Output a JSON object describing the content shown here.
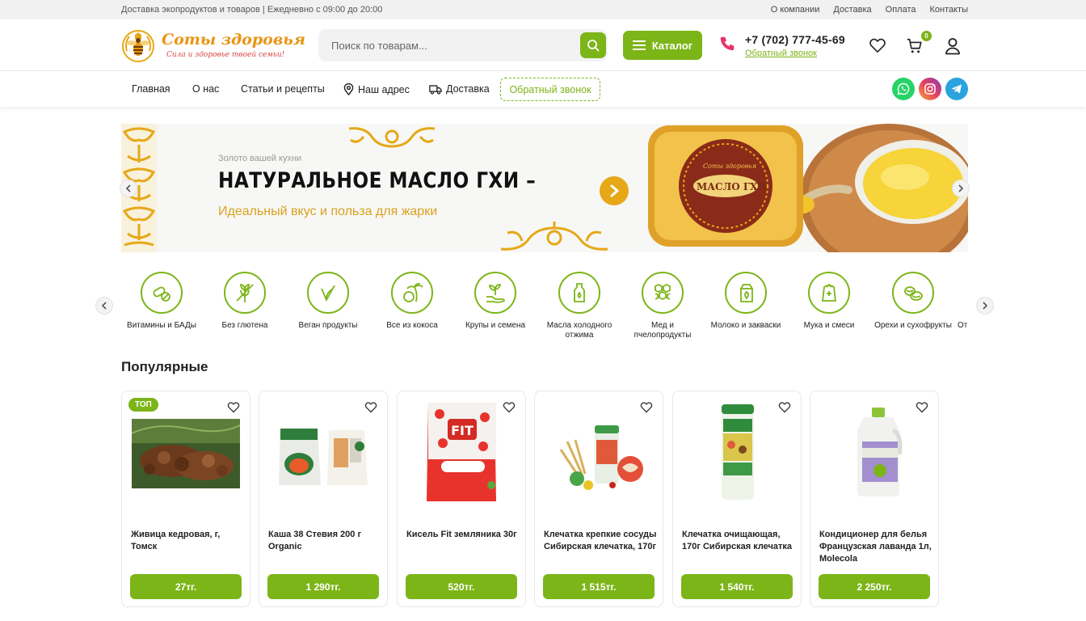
{
  "topbar": {
    "info": "Доставка экопродуктов и товаров | Ежедневно с 09:00 до 20:00",
    "links": [
      "О компании",
      "Доставка",
      "Оплата",
      "Контакты"
    ]
  },
  "header": {
    "logo_title": "Соты здоровья",
    "logo_tagline": "Сила и здоровье твоей семьи!",
    "search_placeholder": "Поиск по товарам...",
    "catalog_label": "Каталог",
    "phone": "+7 (702) 777-45-69",
    "callback_link": "Обратный звонок",
    "cart_count": "0"
  },
  "nav": {
    "items": [
      "Главная",
      "О нас",
      "Статьи и рецепты",
      "Наш адрес",
      "Доставка"
    ],
    "callback_button": "Обратный звонок"
  },
  "banner": {
    "subtitle": "Золото вашей кухни",
    "title": "НАТУРАЛЬНОЕ МАСЛО ГХИ –",
    "description": "Идеальный вкус и польза для жарки",
    "product_label": "МАСЛО ГХИ",
    "product_brand": "Соты здоровья"
  },
  "categories": [
    "Витамины и БАДы",
    "Без глютена",
    "Веган продукты",
    "Все из кокоса",
    "Крупы и семена",
    "Масла холодного отжима",
    "Мед и пчелопродукты",
    "Молоко и закваски",
    "Мука и смеси",
    "Орехи и сухофрукты",
    "От"
  ],
  "popular": {
    "title": "Популярные",
    "badge": "ТОП",
    "products": [
      {
        "name": "Живица кедровая, г, Томск",
        "price": "27тг."
      },
      {
        "name": "Каша 38 Стевия 200 г Organic",
        "price": "1 290тг."
      },
      {
        "name": "Кисель Fit земляника 30г",
        "price": "520тг."
      },
      {
        "name": "Клечатка крепкие сосуды Сибирская клечатка, 170г",
        "price": "1 515тг."
      },
      {
        "name": "Клечатка очищающая, 170г Сибирская клечатка",
        "price": "1 540тг."
      },
      {
        "name": "Кондиционер для белья Французская лаванда 1л, Molecola",
        "price": "2 250тг."
      }
    ]
  },
  "colors": {
    "accent": "#7cb518",
    "gold": "#e6a817",
    "brand_orange": "#e99413"
  },
  "icons": [
    "search-icon",
    "menu-icon",
    "phone-icon",
    "heart-icon",
    "cart-icon",
    "user-icon",
    "location-icon",
    "truck-icon",
    "whatsapp-icon",
    "instagram-icon",
    "telegram-icon",
    "chevron-left-icon",
    "chevron-right-icon"
  ]
}
